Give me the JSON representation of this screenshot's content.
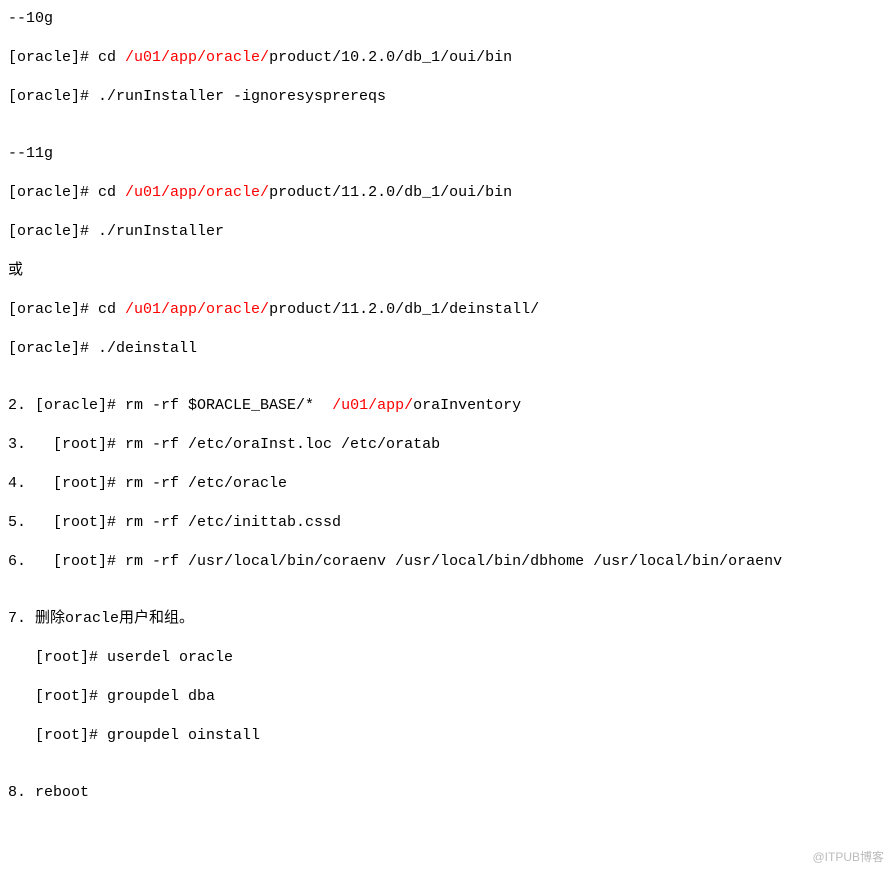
{
  "l1_a": "--10g",
  "l2_a": "[oracle]# cd ",
  "l2_b": "/u01/app/oracle/",
  "l2_c": "product/10.2.0/db_1/oui/bin",
  "l3_a": "[oracle]# ./runInstaller -ignoresysprereqs",
  "l4_a": "--11g",
  "l5_a": "[oracle]# cd ",
  "l5_b": "/u01/app/oracle/",
  "l5_c": "product/11.2.0/db_1/oui/bin",
  "l6_a": "[oracle]# ./runInstaller",
  "l7_a": "或",
  "l8_a": "[oracle]# cd ",
  "l8_b": "/u01/app/oracle/",
  "l8_c": "product/11.2.0/db_1/deinstall/",
  "l9_a": "[oracle]# ./deinstall",
  "l10_a": "2. [oracle]# rm -rf $ORACLE_BASE/*  ",
  "l10_b": "/u01/app/",
  "l10_c": "oraInventory",
  "l11_a": "3.   [root]# rm -rf /etc/oraInst.loc /etc/oratab",
  "l12_a": "4.   [root]# rm -rf /etc/oracle",
  "l13_a": "5.   [root]# rm -rf /etc/inittab.cssd",
  "l14_a": "6.   [root]# rm -rf /usr/local/bin/coraenv /usr/local/bin/dbhome /usr/local/bin/oraenv",
  "l15_a": "7. 删除oracle用户和组。",
  "l16_a": "   [root]# userdel oracle",
  "l17_a": "   [root]# groupdel dba",
  "l18_a": "   [root]# groupdel oinstall",
  "l19_a": "8. reboot",
  "watermark": "@ITPUB博客"
}
